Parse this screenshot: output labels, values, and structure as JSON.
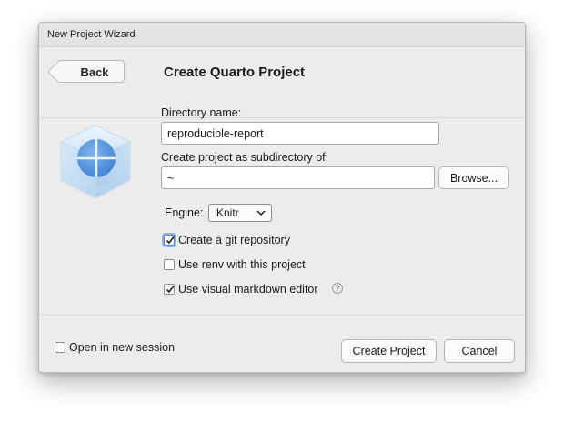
{
  "window": {
    "title": "New Project Wizard"
  },
  "header": {
    "back_label": "Back",
    "page_title": "Create Quarto Project"
  },
  "form": {
    "directory_name": {
      "label": "Directory name:",
      "value": "reproducible-report"
    },
    "subdirectory": {
      "label": "Create project as subdirectory of:",
      "value": "~",
      "browse_label": "Browse..."
    },
    "engine": {
      "label": "Engine:",
      "selected": "Knitr"
    },
    "options": [
      {
        "label": "Create a git repository",
        "checked": true,
        "focused": true
      },
      {
        "label": "Use renv with this project",
        "checked": false,
        "focused": false
      },
      {
        "label": "Use visual markdown editor",
        "checked": true,
        "focused": false
      }
    ],
    "help_glyph": "?"
  },
  "footer": {
    "open_new_session": {
      "label": "Open in new session",
      "checked": false
    },
    "create_label": "Create Project",
    "cancel_label": "Cancel"
  },
  "icons": {
    "logo": "quarto-cube-icon",
    "check": "checkmark-icon",
    "help": "help-icon",
    "dropdown": "chevron-up-down-icon"
  }
}
